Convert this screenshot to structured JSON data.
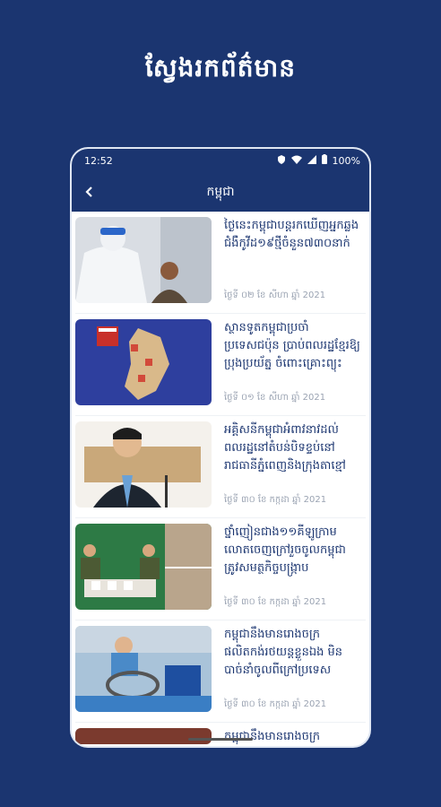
{
  "promo": {
    "title": "ស្វែងរកព័ត៌មាន"
  },
  "status": {
    "time": "12:52",
    "battery": "100%"
  },
  "appbar": {
    "title": "កម្ពុជា"
  },
  "articles": [
    {
      "headline": "ថ្ងៃនេះកម្ពុជាបន្តរកឃើញអ្នកឆ្លងជំងឺកូវីដ១៩ថ្មីចំនួន៧៣០នាក់",
      "date": "ថ្ងៃទី ០២ ខែ សីហា ឆ្នាំ 2021"
    },
    {
      "headline": "ស្ថានទូតកម្ពុជាប្រចាំប្រទេសជប៉ុន ប្រាប់ពលរដ្ឋខ្មែរឱ្យប្រុងប្រយ័ត្ន ចំពោះគ្រោះព្យុះ",
      "date": "ថ្ងៃទី ០១ ខែ សីហា ឆ្នាំ 2021"
    },
    {
      "headline": "អគ្គិសនីកម្ពុជាអំពាវនាវដល់ពលរដ្ឋនៅតំបន់បិទខ្ទប់នៅរាជធានីភ្នំពេញនិងក្រុងតាខ្មៅ",
      "date": "ថ្ងៃទី ៣០ ខែ កក្កដា ឆ្នាំ 2021"
    },
    {
      "headline": "ថ្នាំញៀនជាង១១គីឡូក្រាម លោតចេញក្រៅរួចចូលកម្ពុជា ត្រូវសមត្ថកិច្ចបង្ក្រាប",
      "date": "ថ្ងៃទី ៣០ ខែ កក្កដា ឆ្នាំ 2021"
    },
    {
      "headline": "កម្ពុជានឹងមានរោងចក្រផលិតកង់រថយន្តខ្លួនឯង មិនបាច់នាំចូលពីក្រៅប្រទេស",
      "date": "ថ្ងៃទី ៣០ ខែ កក្កដា ឆ្នាំ 2021"
    }
  ],
  "partial_headline": "កម្ពុជានឹងមានរោងចក្រផលិតកង់",
  "colors": {
    "brand": "#1b3570",
    "date": "#9aa3b2",
    "background": "#1b3570"
  }
}
